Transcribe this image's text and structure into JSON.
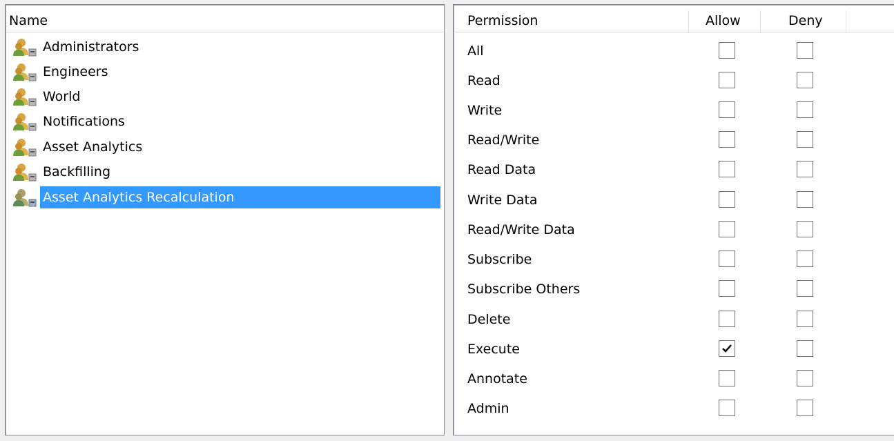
{
  "groups": {
    "column_header": "Name",
    "items": [
      {
        "label": "Administrators"
      },
      {
        "label": "Engineers"
      },
      {
        "label": "World"
      },
      {
        "label": "Notifications"
      },
      {
        "label": "Asset Analytics"
      },
      {
        "label": "Backfilling"
      },
      {
        "label": "Asset Analytics Recalculation",
        "selected": true
      }
    ]
  },
  "permissions": {
    "headers": {
      "permission": "Permission",
      "allow": "Allow",
      "deny": "Deny"
    },
    "rows": [
      {
        "label": "All",
        "allow": false,
        "deny": false
      },
      {
        "label": "Read",
        "allow": false,
        "deny": false
      },
      {
        "label": "Write",
        "allow": false,
        "deny": false
      },
      {
        "label": "Read/Write",
        "allow": false,
        "deny": false
      },
      {
        "label": "Read Data",
        "allow": false,
        "deny": false
      },
      {
        "label": "Write Data",
        "allow": false,
        "deny": false
      },
      {
        "label": "Read/Write Data",
        "allow": false,
        "deny": false
      },
      {
        "label": "Subscribe",
        "allow": false,
        "deny": false
      },
      {
        "label": "Subscribe Others",
        "allow": false,
        "deny": false
      },
      {
        "label": "Delete",
        "allow": false,
        "deny": false
      },
      {
        "label": "Execute",
        "allow": true,
        "deny": false
      },
      {
        "label": "Annotate",
        "allow": false,
        "deny": false
      },
      {
        "label": "Admin",
        "allow": false,
        "deny": false
      }
    ]
  },
  "icons": {
    "group": "user-group-icon",
    "check": "checkmark-icon"
  },
  "colors": {
    "selection": "#3399ff",
    "border": "#828790"
  }
}
